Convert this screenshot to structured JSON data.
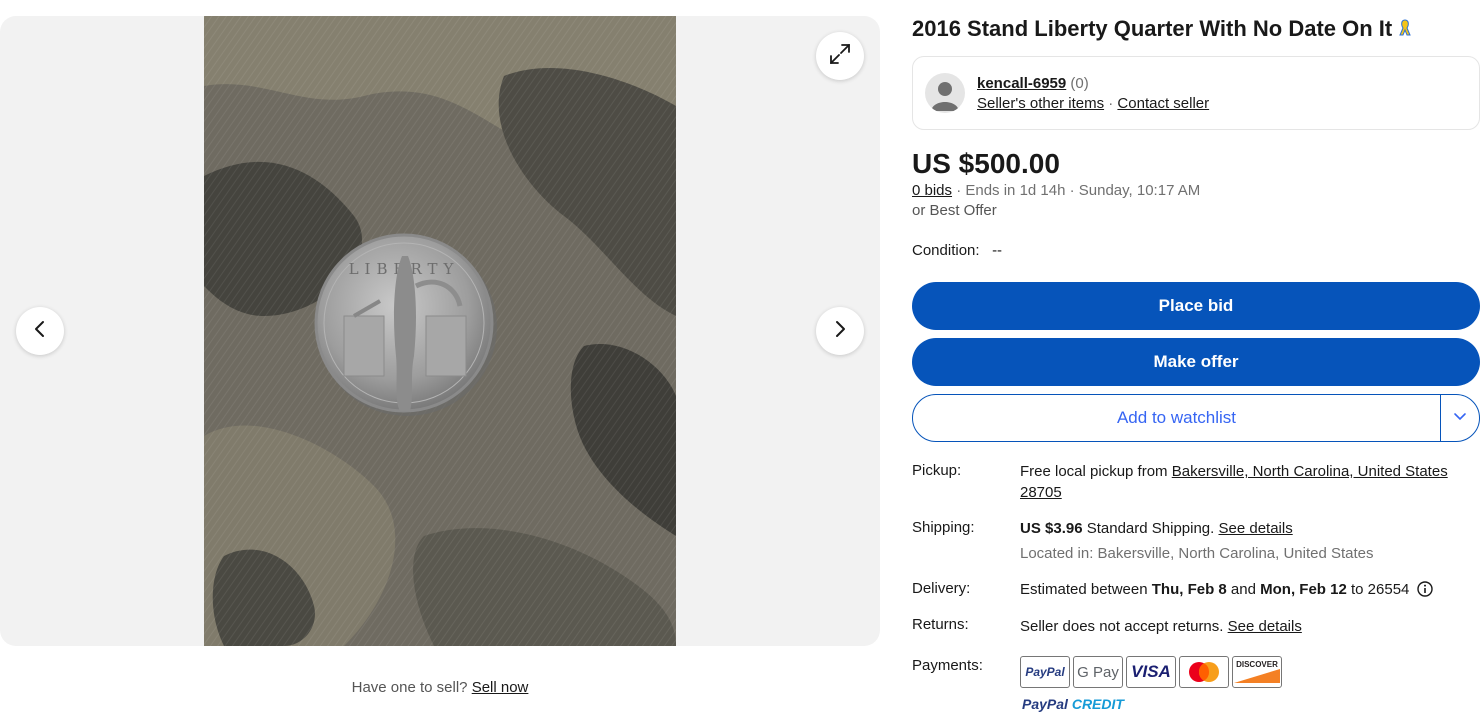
{
  "gallery": {
    "sell_prompt": "Have one to sell?",
    "sell_link": "Sell now"
  },
  "listing": {
    "title": "2016 Stand Liberty Quarter With No Date On It",
    "coin_legend": "LIBERTY"
  },
  "seller": {
    "name": "kencall-6959",
    "score": "(0)",
    "other_items": "Seller's other items",
    "separator": "·",
    "contact": "Contact seller"
  },
  "pricing": {
    "price": "US $500.00",
    "bids": "0 bids",
    "ends": "· Ends in 1d 14h · Sunday, 10:17 AM",
    "best_offer": "or Best Offer"
  },
  "condition": {
    "label": "Condition:",
    "value": "--"
  },
  "actions": {
    "place_bid": "Place bid",
    "make_offer": "Make offer",
    "watchlist": "Add to watchlist"
  },
  "details": {
    "pickup_label": "Pickup:",
    "pickup_prefix": "Free local pickup from",
    "pickup_location": "Bakersville, North Carolina, United States 28705",
    "shipping_label": "Shipping:",
    "shipping_price": "US $3.96",
    "shipping_method": "Standard Shipping.",
    "shipping_details": "See details",
    "located_in": "Located in: Bakersville, North Carolina, United States",
    "delivery_label": "Delivery:",
    "delivery_prefix": "Estimated between",
    "delivery_start": "Thu, Feb 8",
    "delivery_and": "and",
    "delivery_end": "Mon, Feb 12",
    "delivery_to": "to 26554",
    "returns_label": "Returns:",
    "returns_text": "Seller does not accept returns.",
    "returns_details": "See details",
    "payments_label": "Payments:"
  },
  "payments": {
    "paypal": "PayPal",
    "gpay": "G Pay",
    "visa": "VISA",
    "discover": "DISCOVER",
    "paypal_credit_a": "PayPal",
    "paypal_credit_b": "CREDIT"
  },
  "colors": {
    "primary_button": "#0654ba",
    "link_blue": "#3665f3",
    "text": "#191919",
    "muted": "#707070"
  }
}
